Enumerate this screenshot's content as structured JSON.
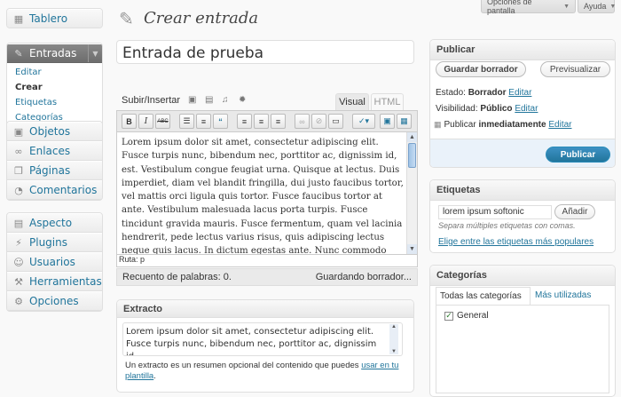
{
  "topbar": {
    "screen_options": "Opciones de pantalla",
    "help": "Ayuda"
  },
  "sidebar": {
    "dashboard": "Tablero",
    "posts": "Entradas",
    "posts_sub": [
      "Editar",
      "Crear",
      "Etiquetas",
      "Categorías"
    ],
    "group2": [
      "Objetos",
      "Enlaces",
      "Páginas",
      "Comentarios"
    ],
    "group3": [
      "Aspecto",
      "Plugins",
      "Usuarios",
      "Herramientas",
      "Opciones"
    ]
  },
  "page": {
    "title": "Crear entrada",
    "post_title": "Entrada de prueba"
  },
  "editor": {
    "upload_label": "Subir/Insertar",
    "tab_visual": "Visual",
    "tab_html": "HTML",
    "body": "Lorem ipsum dolor sit amet, consectetur adipiscing elit. Fusce turpis nunc, bibendum nec, porttitor ac, dignissim id, est. Vestibulum congue feugiat urna. Quisque at lectus. Duis imperdiet, diam vel blandit fringilla, dui justo faucibus tortor, vel mattis orci ligula quis tortor. Fusce faucibus tortor at ante. Vestibulum malesuada lacus porta turpis. Fusce tincidunt gravida mauris. Fusce fermentum, quam vel lacinia hendrerit, pede lectus varius risus, quis adipiscing lectus neque quis lacus. In dictum egestas ante. Nunc commodo lectus at sapien. Sed ac ligula. Pellentesque ut elit. Mauris rutrum",
    "path": "Ruta: p",
    "word_count": "Recuento de palabras: 0.",
    "saving": "Guardando borrador..."
  },
  "excerpt": {
    "title": "Extracto",
    "text": "Lorem ipsum dolor sit amet, consectetur adipiscing elit. Fusce turpis nunc, bibendum nec, porttitor ac, dignissim id,",
    "help": "Un extracto es un resumen opcional del contenido que puedes",
    "help_link": "usar en tu plantilla",
    "help_end": "."
  },
  "publish": {
    "title": "Publicar",
    "save_draft": "Guardar borrador",
    "preview": "Previsualizar",
    "status_label": "Estado:",
    "status_value": "Borrador",
    "visibility_label": "Visibilidad:",
    "visibility_value": "Público",
    "publish_label": "Publicar",
    "publish_value": "inmediatamente",
    "edit": "Editar",
    "publish_button": "Publicar"
  },
  "tags": {
    "title": "Etiquetas",
    "input_value": "lorem ipsum softonic",
    "add": "Añadir",
    "hint": "Separa múltiples etiquetas con comas.",
    "popular": "Elige entre las etiquetas más populares"
  },
  "categories": {
    "title": "Categorías",
    "tab_all": "Todas las categorías",
    "tab_used": "Más utilizadas",
    "item": "General"
  },
  "colors": {
    "link": "#21759b",
    "publish_btn": "#2e7bab",
    "active_menu": "#777777"
  }
}
